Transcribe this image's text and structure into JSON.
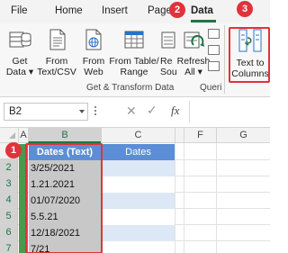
{
  "ribbon": {
    "tabs": [
      "File",
      "Home",
      "Insert",
      "Page",
      "Data"
    ],
    "active_tab": "Data",
    "commands": {
      "get_data": [
        "Get",
        "Data ▾"
      ],
      "from_text": [
        "From",
        "Text/CSV"
      ],
      "from_web": [
        "From",
        "Web"
      ],
      "from_table": [
        "From Table/",
        "Range"
      ],
      "recent": [
        "Re",
        "Sou"
      ],
      "refresh": [
        "Refresh",
        "All ▾"
      ],
      "text_to_columns": [
        "Text to",
        "Columns"
      ]
    },
    "groups": {
      "get_transform": "Get & Transform Data",
      "queries": "Queri"
    }
  },
  "callouts": {
    "one": "1",
    "two": "2",
    "three": "3"
  },
  "formula_bar": {
    "name_box": "B2",
    "cancel": "✕",
    "enter": "✓",
    "fx": "fx"
  },
  "grid": {
    "columns": [
      "A",
      "B",
      "C",
      "D",
      "F",
      "G"
    ],
    "rows": [
      {
        "num": "1",
        "b": "Dates (Text)",
        "c": "Dates"
      },
      {
        "num": "2",
        "b": "3/25/2021",
        "c": ""
      },
      {
        "num": "3",
        "b": "1.21.2021",
        "c": ""
      },
      {
        "num": "4",
        "b": "01/07/2020",
        "c": ""
      },
      {
        "num": "5",
        "b": "5.5.21",
        "c": ""
      },
      {
        "num": "6",
        "b": "12/18/2021",
        "c": ""
      },
      {
        "num": "7",
        "b": "7/21",
        "c": ""
      }
    ]
  },
  "colors": {
    "accent_green": "#217346",
    "highlight_red": "#e0333b",
    "table_header_blue": "#5b8ed6",
    "table_band_blue": "#dde8f6",
    "selection_gray": "#c8c8c8"
  }
}
